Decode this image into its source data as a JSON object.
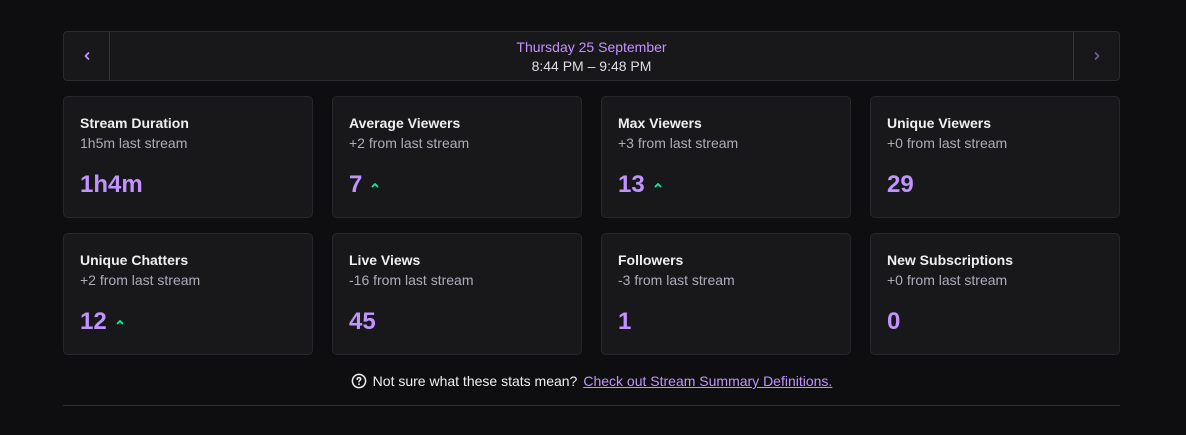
{
  "date_nav": {
    "date": "Thursday 25 September",
    "time_range": "8:44 PM – 9:48 PM",
    "prev_icon": "chevron-left-icon",
    "next_icon": "chevron-right-icon"
  },
  "colors": {
    "accent": "#bf94ff",
    "trend_up": "#00f593",
    "background": "#0e0e10",
    "card": "#18181b"
  },
  "cards": [
    {
      "title": "Stream Duration",
      "subtitle": "1h5m last stream",
      "value": "1h4m",
      "trend": "none"
    },
    {
      "title": "Average Viewers",
      "subtitle": "+2 from last stream",
      "value": "7",
      "trend": "up"
    },
    {
      "title": "Max Viewers",
      "subtitle": "+3 from last stream",
      "value": "13",
      "trend": "up"
    },
    {
      "title": "Unique Viewers",
      "subtitle": "+0 from last stream",
      "value": "29",
      "trend": "none"
    },
    {
      "title": "Unique Chatters",
      "subtitle": "+2 from last stream",
      "value": "12",
      "trend": "up"
    },
    {
      "title": "Live Views",
      "subtitle": "-16 from last stream",
      "value": "45",
      "trend": "none"
    },
    {
      "title": "Followers",
      "subtitle": "-3 from last stream",
      "value": "1",
      "trend": "none"
    },
    {
      "title": "New Subscriptions",
      "subtitle": "+0 from last stream",
      "value": "0",
      "trend": "none"
    }
  ],
  "help": {
    "icon": "question-circle-icon",
    "text": "Not sure what these stats mean?",
    "link_text": "Check out Stream Summary Definitions."
  }
}
